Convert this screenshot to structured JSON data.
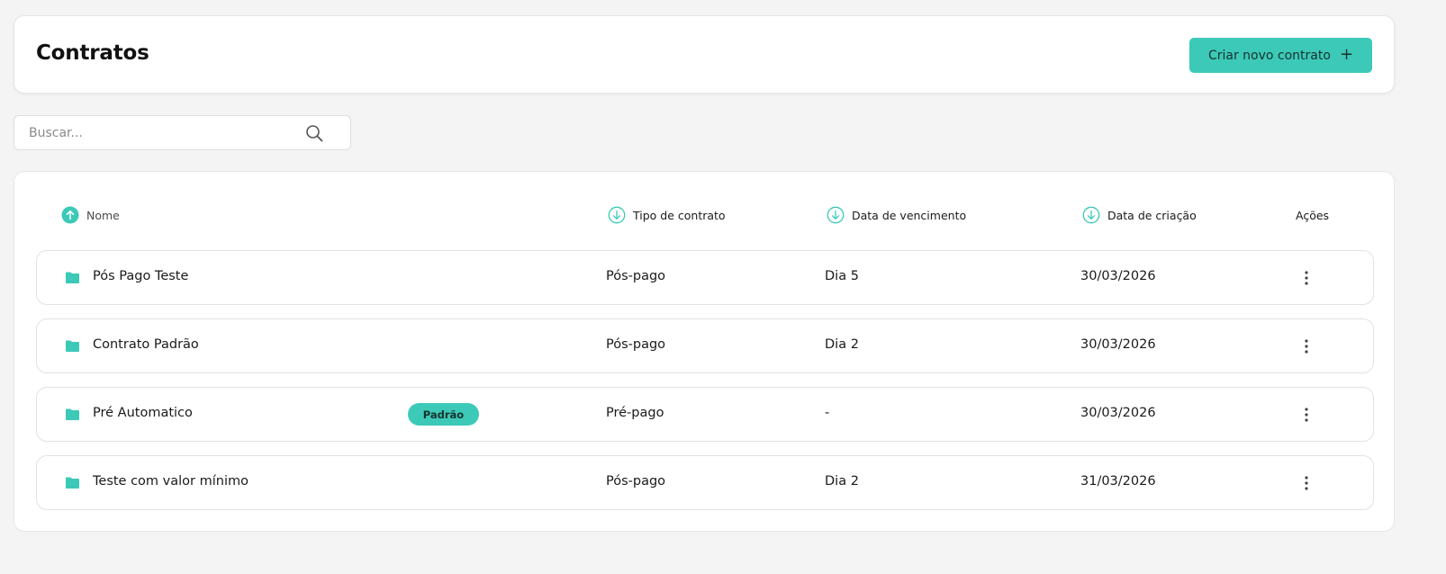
{
  "header": {
    "title": "Contratos",
    "create_button_label": "Criar novo contrato",
    "create_button_icon": "plus-icon"
  },
  "search": {
    "placeholder": "Buscar...",
    "value": "",
    "icon": "search-icon"
  },
  "table": {
    "columns": {
      "nome": "Nome",
      "tipo": "Tipo de contrato",
      "vencimento": "Data de vencimento",
      "criacao": "Data de criação",
      "acoes": "Ações"
    },
    "sort": {
      "nome": "ascending (active)",
      "tipo": "descending",
      "vencimento": "descending",
      "criacao": "descending"
    },
    "rows": [
      {
        "name": "Pós Pago Teste",
        "badge": "",
        "tipo": "Pós-pago",
        "vencimento": "Dia 5",
        "criacao": "30/03/2026"
      },
      {
        "name": "Contrato Padrão",
        "badge": "",
        "tipo": "Pós-pago",
        "vencimento": "Dia 2",
        "criacao": "30/03/2026"
      },
      {
        "name": "Pré Automatico",
        "badge": "Padrão",
        "tipo": "Pré-pago",
        "vencimento": "-",
        "criacao": "30/03/2026"
      },
      {
        "name": "Teste com valor mínimo",
        "badge": "",
        "tipo": "Pós-pago",
        "vencimento": "Dia 2",
        "criacao": "31/03/2026"
      }
    ]
  },
  "colors": {
    "accent": "#3cc9b8",
    "background": "#f4f4f4",
    "card": "#ffffff",
    "border": "#e2e2e2"
  }
}
